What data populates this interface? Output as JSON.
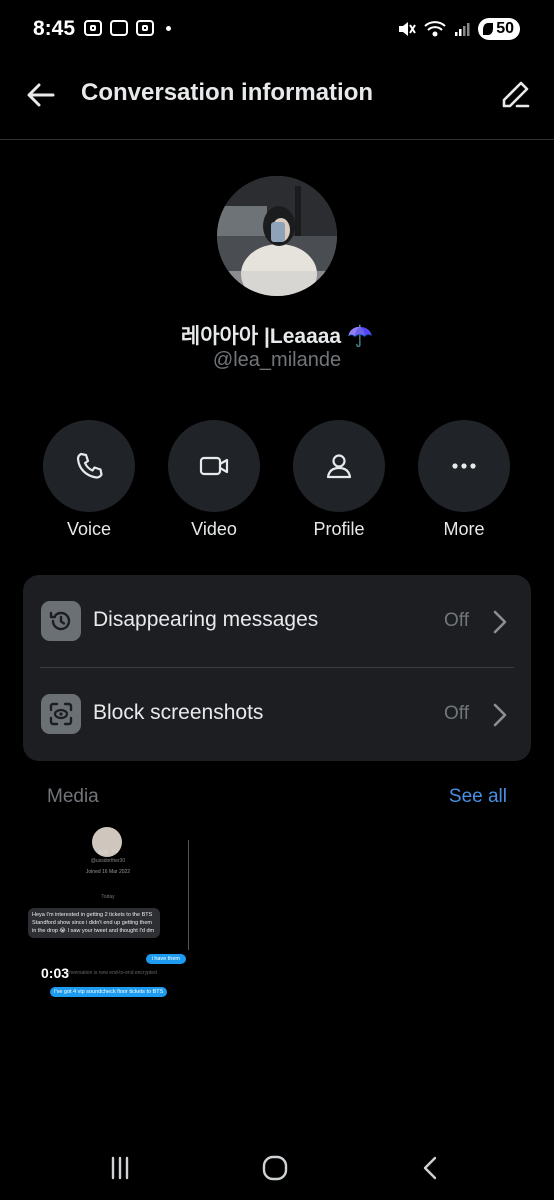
{
  "status_bar": {
    "time": "8:45",
    "battery": "50"
  },
  "header": {
    "title": "Conversation information",
    "back_icon": "arrow-left-icon",
    "edit_icon": "pencil-icon"
  },
  "profile": {
    "display_name": "레아아아 |Leaaaa ☂️",
    "handle": "@lea_milande"
  },
  "actions": [
    {
      "label": "Voice",
      "icon": "phone-icon"
    },
    {
      "label": "Video",
      "icon": "video-camera-icon"
    },
    {
      "label": "Profile",
      "icon": "person-icon"
    },
    {
      "label": "More",
      "icon": "more-horizontal-icon"
    }
  ],
  "settings": [
    {
      "label": "Disappearing messages",
      "value": "Off",
      "icon": "timer-icon"
    },
    {
      "label": "Block screenshots",
      "value": "Off",
      "icon": "screenshot-icon"
    }
  ],
  "media": {
    "label": "Media",
    "see_all": "See all",
    "thumbnail": {
      "duration": "0:03",
      "name": "Ash .* •",
      "handle": "@ussdorther30",
      "joined": "Joined 16 Mar 2022",
      "today": "Today",
      "message_1": "Heya I'm interested in getting 2 tickets to the BTS Standford show since i didn't end up getting them in the drop 😭 I saw your tweet and thought I'd dm",
      "message_2": "i have them",
      "encryption": "conversation is now end-to-end encrypted",
      "message_3": "I've got 4 vip soundcheck floor tickets to BTS"
    }
  },
  "colors": {
    "background": "#000000",
    "card": "#1c1e21",
    "action_circle": "#202327",
    "link": "#4a90e2",
    "muted": "#71767b"
  }
}
